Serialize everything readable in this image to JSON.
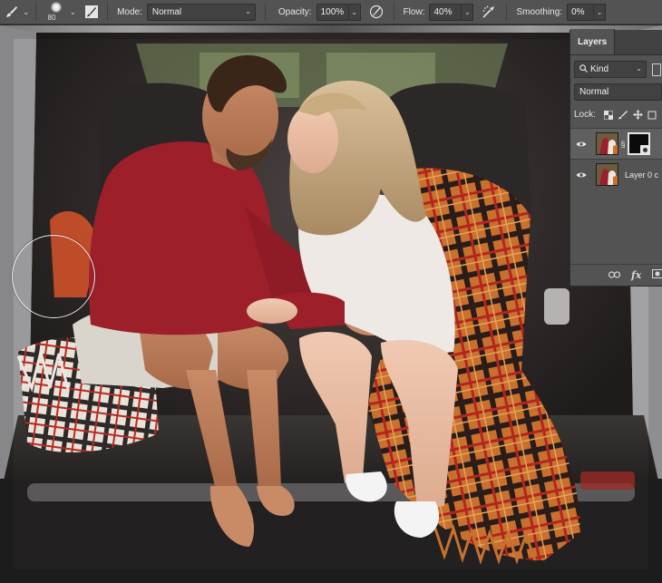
{
  "options_bar": {
    "tool_icon": "brush-tool-icon",
    "brush_size": "80",
    "mode_label": "Mode:",
    "mode_value": "Normal",
    "opacity_label": "Opacity:",
    "opacity_value": "100%",
    "pressure_opacity_icon": "pen-pressure-icon",
    "flow_label": "Flow:",
    "flow_value": "40%",
    "airbrush_icon": "airbrush-icon",
    "smoothing_label": "Smoothing:",
    "smoothing_value": "0%"
  },
  "layers_panel": {
    "tab_label": "Layers",
    "filter_value": "Kind",
    "blend_mode": "Normal",
    "lock_label": "Lock:",
    "layers": [
      {
        "name": "",
        "has_mask": true,
        "visible": true,
        "selected": true
      },
      {
        "name": "Layer 0 c",
        "has_mask": false,
        "visible": true,
        "selected": false
      }
    ],
    "footer_fx": "fx"
  },
  "colors": {
    "panel_bg": "#535353",
    "optbar_bg": "#535353",
    "sweater_red": "#9c1f2a",
    "plaid_orange": "#c76a2a"
  }
}
